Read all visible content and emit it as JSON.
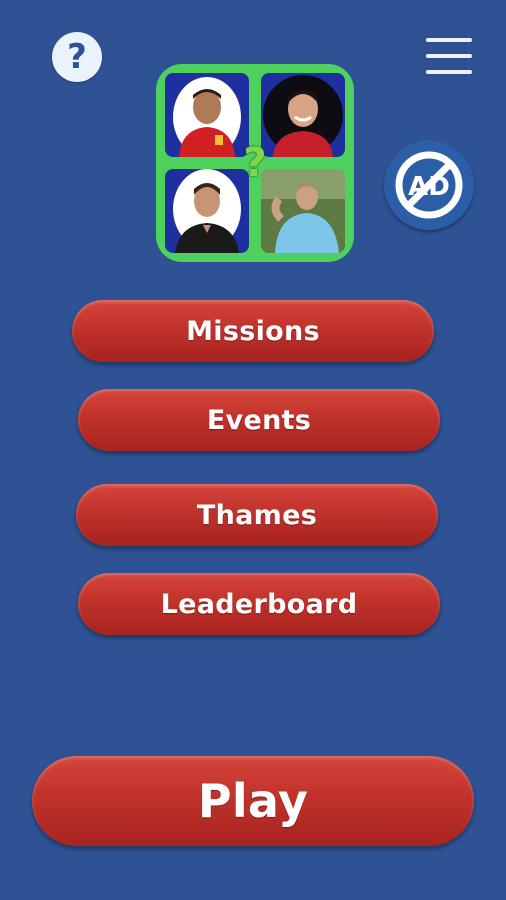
{
  "header": {
    "help_icon_glyph": "?",
    "menu_icon": "hamburger-menu-icon",
    "no_ads_icon": "no-ads-icon",
    "no_ads_text": "AD"
  },
  "logo": {
    "center_glyph": "?",
    "tiles": [
      "player-photo-1",
      "player-photo-2",
      "player-photo-3",
      "player-photo-4"
    ]
  },
  "menu": {
    "missions": "Missions",
    "events": "Events",
    "thames": "Thames",
    "leaderboard": "Leaderboard"
  },
  "play": {
    "label": "Play"
  },
  "colors": {
    "background": "#2e5294",
    "button_red": "#c1322c",
    "logo_green": "#4fd15e",
    "tile_blue": "#1e2fa0"
  }
}
